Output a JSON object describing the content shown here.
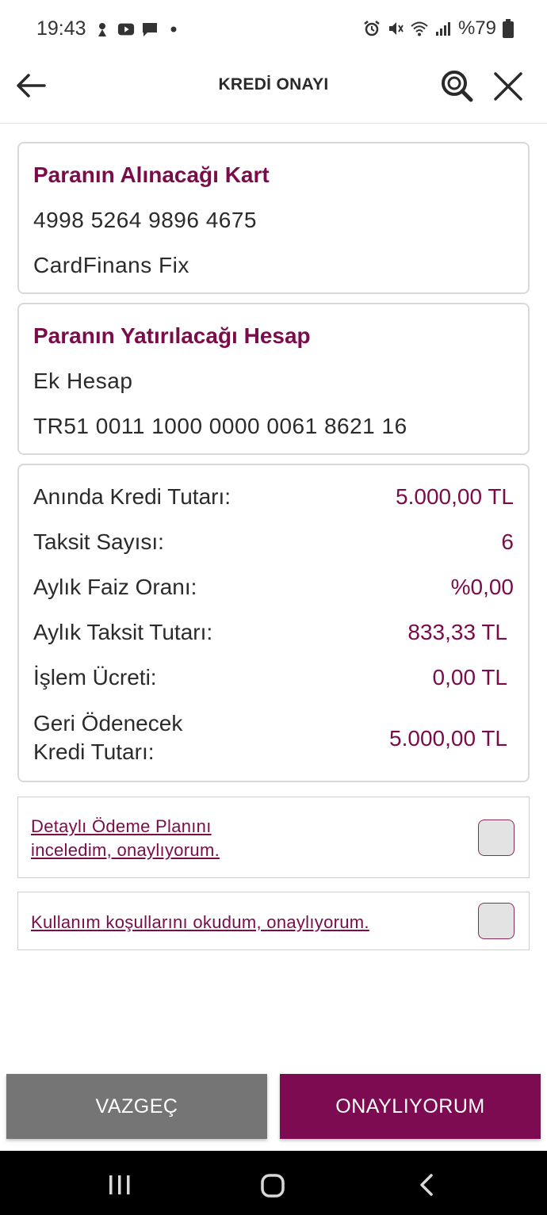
{
  "status_bar": {
    "time": "19:43",
    "battery_text": "%79",
    "icons_left": [
      "vpn-key-icon",
      "youtube-icon",
      "message-icon",
      "dot-icon"
    ],
    "icons_right": [
      "alarm-icon",
      "mute-icon",
      "wifi-icon",
      "signal-icon",
      "battery-icon"
    ]
  },
  "header": {
    "title": "KREDİ ONAYI",
    "back_icon": "arrow-left-icon",
    "search_icon": "search-icon",
    "close_icon": "close-icon"
  },
  "source_card": {
    "title": "Paranın Alınacağı Kart",
    "card_number": "4998 5264 9896 4675",
    "card_name": "CardFinans Fix"
  },
  "target_card": {
    "title": "Paranın Yatırılacağı Hesap",
    "account_name": "Ek Hesap",
    "iban": "TR51 0011 1000 0000 0061 8621 16"
  },
  "details": {
    "rows": [
      {
        "label": "Anında Kredi Tutarı:",
        "value": "5.000,00 TL"
      },
      {
        "label": "Taksit Sayısı:",
        "value": "6"
      },
      {
        "label": "Aylık Faiz Oranı:",
        "value": "%0,00"
      },
      {
        "label": "Aylık Taksit Tutarı:",
        "value": "833,33 TL"
      },
      {
        "label": "İşlem Ücreti:",
        "value": "0,00 TL"
      }
    ],
    "repay_label_line1": "Geri Ödenecek",
    "repay_label_line2": "Kredi Tutarı:",
    "repay_value": "5.000,00 TL"
  },
  "agreements": {
    "payment_plan_line1": "Detaylı Ödeme Planını",
    "payment_plan_line2": "inceledim, onaylıyorum.",
    "payment_plan_checked": false,
    "terms": "Kullanım koşullarını okudum, onaylıyorum.",
    "terms_checked": false
  },
  "buttons": {
    "cancel": "VAZGEÇ",
    "confirm": "ONAYLIYORUM"
  },
  "colors": {
    "accent": "#7a0c4a",
    "confirm_button": "#7d0b52",
    "cancel_button": "#757575"
  }
}
